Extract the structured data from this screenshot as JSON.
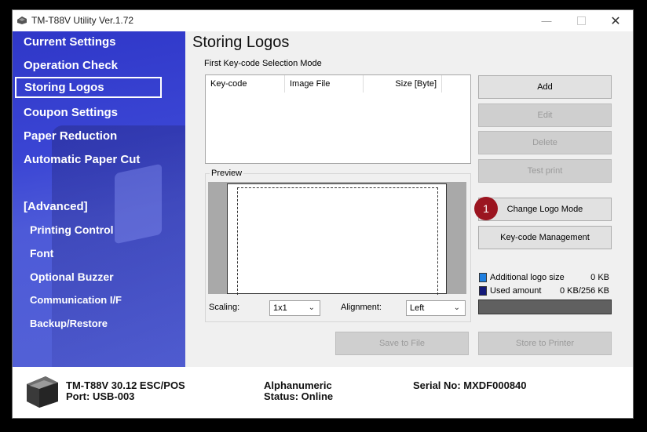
{
  "window": {
    "title": "TM-T88V Utility Ver.1.72"
  },
  "sidebar": {
    "items": [
      {
        "label": "Current Settings"
      },
      {
        "label": "Operation Check"
      },
      {
        "label": "Storing Logos"
      },
      {
        "label": "Coupon Settings"
      },
      {
        "label": "Paper Reduction"
      },
      {
        "label": "Automatic Paper Cut"
      }
    ],
    "advanced_header": "[Advanced]",
    "advanced_items": [
      {
        "label": "Printing Control"
      },
      {
        "label": "Font"
      },
      {
        "label": "Optional Buzzer"
      },
      {
        "label": "Communication I/F"
      },
      {
        "label": "Backup/Restore"
      }
    ],
    "selected": "Storing Logos"
  },
  "main": {
    "title": "Storing Logos",
    "mode_label": "First Key-code Selection Mode",
    "table": {
      "columns": [
        "Key-code",
        "Image File",
        "Size [Byte]"
      ],
      "rows": []
    },
    "preview": {
      "label": "Preview",
      "scaling_label": "Scaling:",
      "scaling_value": "1x1",
      "alignment_label": "Alignment:",
      "alignment_value": "Left"
    },
    "buttons": {
      "add": "Add",
      "edit": "Edit",
      "delete": "Delete",
      "test_print": "Test print",
      "change_logo_mode": "Change Logo Mode",
      "keycode_management": "Key-code Management",
      "save_to_file": "Save to File",
      "store_to_printer": "Store to Printer"
    },
    "badge": "1",
    "legend": {
      "additional_label": "Additional logo size",
      "additional_value": "0 KB",
      "additional_color": "#1f7fe0",
      "used_label": "Used amount",
      "used_value": "0 KB/256 KB",
      "used_color": "#141a7a"
    }
  },
  "status": {
    "model": "TM-T88V 30.12 ESC/POS",
    "port": "Port: USB-003",
    "charset": "Alphanumeric",
    "status": "Status: Online",
    "serial": "Serial No: MXDF000840"
  }
}
